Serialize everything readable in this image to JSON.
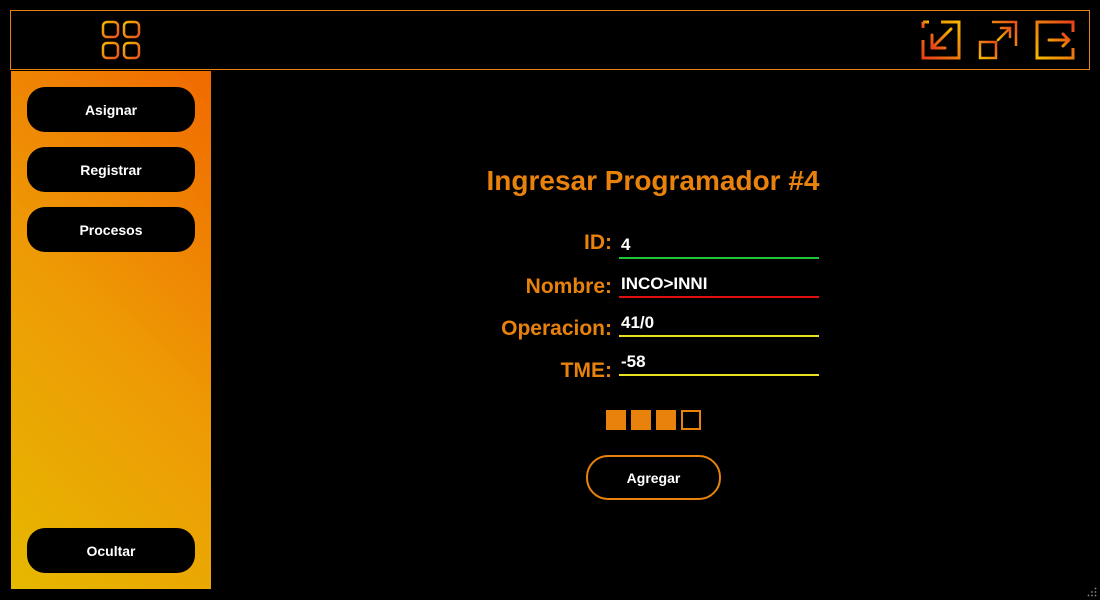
{
  "colors": {
    "accent": "#e8820c",
    "id_underline": "#22c53a",
    "nombre_underline": "#e01010",
    "operacion_underline": "#e8e020",
    "tme_underline": "#e8e020"
  },
  "topbar": {
    "menu_icon": "grid-icon",
    "actions": [
      "minimize-icon",
      "maximize-icon",
      "exit-icon"
    ]
  },
  "sidebar": {
    "items": [
      {
        "label": "Asignar"
      },
      {
        "label": "Registrar"
      },
      {
        "label": "Procesos"
      }
    ],
    "hide_label": "Ocultar"
  },
  "form": {
    "title": "Ingresar Programador #4",
    "fields": [
      {
        "label": "ID:",
        "value": "4"
      },
      {
        "label": "Nombre:",
        "value": "INCO>INNI"
      },
      {
        "label": "Operacion:",
        "value": "41/0"
      },
      {
        "label": "TME:",
        "value": "-58"
      }
    ],
    "progress": {
      "filled": 3,
      "total": 4
    },
    "submit_label": "Agregar"
  }
}
